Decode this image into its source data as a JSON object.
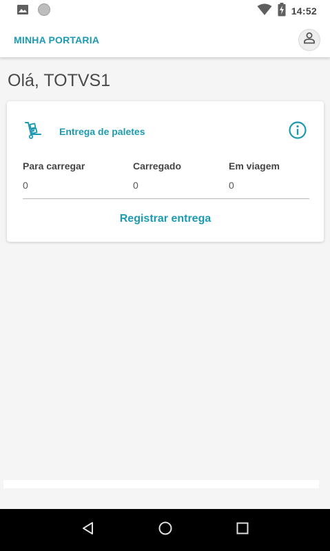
{
  "status_bar": {
    "time": "14:52",
    "icons": [
      "image-icon",
      "circle-notification-icon",
      "wifi-icon",
      "battery-charging-icon"
    ]
  },
  "app_bar": {
    "title": "MINHA PORTARIA",
    "profile_icon": "user-icon"
  },
  "greeting": "Olá, TOTVS1",
  "card": {
    "icon": "hand-truck-icon",
    "title": "Entrega de paletes",
    "info_icon": "info-icon",
    "stats": [
      {
        "label": "Para carregar",
        "value": "0"
      },
      {
        "label": "Carregado",
        "value": "0"
      },
      {
        "label": "Em viagem",
        "value": "0"
      }
    ],
    "action_label": "Registrar entrega"
  },
  "nav_bar": {
    "icons": [
      "back-icon",
      "home-icon",
      "recents-icon"
    ]
  },
  "colors": {
    "accent": "#1b9ab2",
    "background": "#f5f5f5",
    "nav_bar": "#000000"
  }
}
